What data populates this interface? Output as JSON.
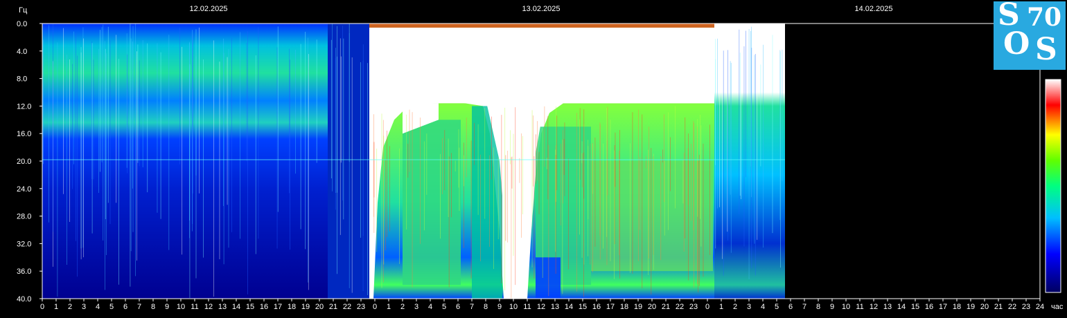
{
  "chart_data": {
    "type": "heatmap",
    "ylabel": "Гц",
    "xlabel": "час",
    "ylim": [
      0,
      40
    ],
    "yticks": [
      "0.0",
      "4.0",
      "8.0",
      "12.0",
      "16.0",
      "20.0",
      "24.0",
      "28.0",
      "32.0",
      "36.0",
      "40.0"
    ],
    "xticks": [
      "0",
      "1",
      "2",
      "3",
      "4",
      "5",
      "6",
      "7",
      "8",
      "9",
      "10",
      "11",
      "12",
      "13",
      "14",
      "15",
      "16",
      "17",
      "18",
      "19",
      "20",
      "21",
      "22",
      "23",
      "0",
      "1",
      "2",
      "3",
      "4",
      "5",
      "6",
      "7",
      "8",
      "9",
      "10",
      "11",
      "12",
      "13",
      "14",
      "15",
      "16",
      "17",
      "18",
      "19",
      "20",
      "21",
      "22",
      "23",
      "0",
      "1",
      "2",
      "3",
      "4",
      "5",
      "6",
      "7",
      "8",
      "9",
      "10",
      "11",
      "12",
      "13",
      "14",
      "15",
      "16",
      "17",
      "18",
      "19",
      "20",
      "21",
      "22",
      "23",
      "24"
    ],
    "dates": [
      "12.02.2025",
      "13.02.2025",
      "14.02.2025"
    ],
    "data_end_hour": 53.6,
    "colorscale": [
      "#00008b",
      "#0000ff",
      "#00bfff",
      "#00ff80",
      "#ffff00",
      "#ff0000",
      "#ffffff"
    ]
  },
  "logo": {
    "text_s1": "S",
    "text_o": "O",
    "text_s2": "S",
    "text_70": "70",
    "bg": "#29a9e0"
  }
}
